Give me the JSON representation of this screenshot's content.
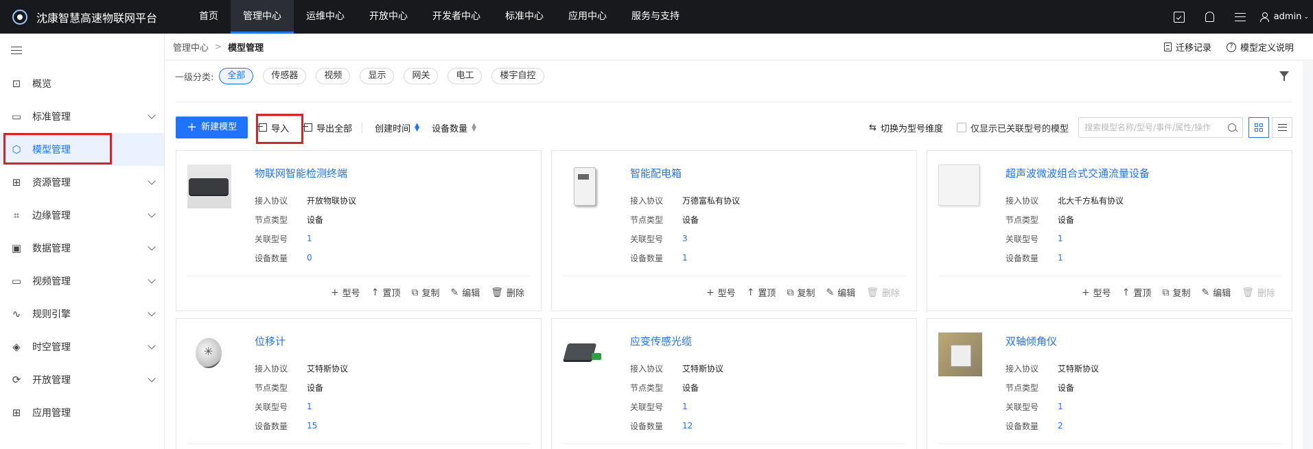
{
  "brand": {
    "title": "沈康智慧高速物联网平台"
  },
  "nav": {
    "items": [
      "首页",
      "管理中心",
      "运维中心",
      "开放中心",
      "开发者中心",
      "标准中心",
      "应用中心",
      "服务与支持"
    ],
    "active_index": 1
  },
  "user": {
    "name": "admin"
  },
  "sidebar": {
    "items": [
      {
        "label": "概览",
        "icon": "overview-icon",
        "has_children": false
      },
      {
        "label": "标准管理",
        "icon": "standard-icon",
        "has_children": true
      },
      {
        "label": "模型管理",
        "icon": "model-icon",
        "has_children": false,
        "active": true
      },
      {
        "label": "资源管理",
        "icon": "resource-icon",
        "has_children": true
      },
      {
        "label": "边缘管理",
        "icon": "edge-icon",
        "has_children": true
      },
      {
        "label": "数据管理",
        "icon": "data-icon",
        "has_children": true
      },
      {
        "label": "视频管理",
        "icon": "video-icon",
        "has_children": true
      },
      {
        "label": "规则引擎",
        "icon": "rule-icon",
        "has_children": true
      },
      {
        "label": "时空管理",
        "icon": "spacetime-icon",
        "has_children": true
      },
      {
        "label": "开放管理",
        "icon": "open-icon",
        "has_children": true
      },
      {
        "label": "应用管理",
        "icon": "app-icon",
        "has_children": false
      }
    ]
  },
  "breadcrumb": {
    "parent": "管理中心",
    "current": "模型管理"
  },
  "header_links": {
    "migration": "迁移记录",
    "model_def": "模型定义说明"
  },
  "filter": {
    "label": "一级分类:",
    "chips": [
      "全部",
      "传感器",
      "视频",
      "显示",
      "网关",
      "电工",
      "楼宇自控"
    ],
    "active_index": 0
  },
  "toolbar": {
    "new_model": "新建模型",
    "import": "导入",
    "export_all": "导出全部",
    "sort_created": "创建时间",
    "sort_count": "设备数量",
    "switch_dim": "切换为型号维度",
    "only_linked": "仅显示已关联型号的模型",
    "search_placeholder": "搜索模型名称/型号/事件/属性/操作"
  },
  "card_labels": {
    "protocol": "接入协议",
    "node_type": "节点类型",
    "linked_model": "关联型号",
    "device_count": "设备数量"
  },
  "card_actions": {
    "model": "型号",
    "pin": "置顶",
    "copy": "复制",
    "edit": "编辑",
    "delete": "删除"
  },
  "cards": [
    {
      "name": "物联网智能检测终端",
      "protocol": "开放物联协议",
      "node_type": "设备",
      "linked": "1",
      "count": "0",
      "thumb": "router",
      "delete_enabled": true
    },
    {
      "name": "智能配电箱",
      "protocol": "万德富私有协议",
      "node_type": "设备",
      "linked": "3",
      "count": "1",
      "thumb": "box",
      "delete_enabled": false
    },
    {
      "name": "超声波微波组合式交通流量设备",
      "protocol": "北大千方私有协议",
      "node_type": "设备",
      "linked": "1",
      "count": "1",
      "thumb": "panel",
      "delete_enabled": false
    },
    {
      "name": "位移计",
      "protocol": "艾特斯协议",
      "node_type": "设备",
      "linked": "1",
      "count": "15",
      "thumb": "disp"
    },
    {
      "name": "应变传感光缆",
      "protocol": "艾特斯协议",
      "node_type": "设备",
      "linked": "1",
      "count": "12",
      "thumb": "sensor"
    },
    {
      "name": "双轴倾角仪",
      "protocol": "艾特斯协议",
      "node_type": "设备",
      "linked": "1",
      "count": "2",
      "thumb": "tilt"
    }
  ],
  "colors": {
    "primary": "#1f73ff",
    "topbar": "#17191c",
    "highlight": "#e02020"
  }
}
